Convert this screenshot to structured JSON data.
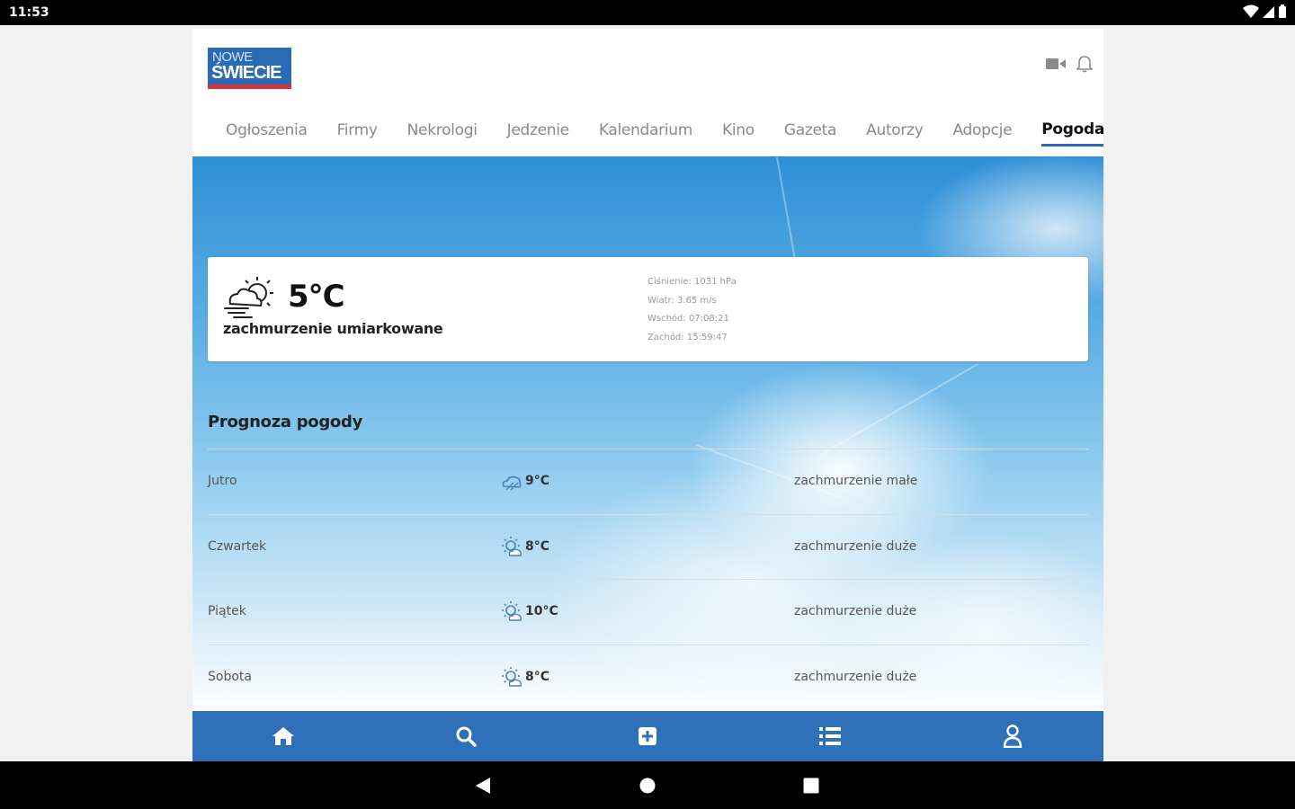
{
  "status_bar": {
    "time": "11:53"
  },
  "brand": {
    "line1": "NOWE",
    "line2": "ŚWIECIE",
    "color": "#2a6bb5",
    "accent": "#d8313a"
  },
  "header": {
    "icons": [
      "video-icon",
      "bell-icon"
    ]
  },
  "nav": {
    "items": [
      {
        "label": "Ogłoszenia"
      },
      {
        "label": "Firmy"
      },
      {
        "label": "Nekrologi"
      },
      {
        "label": "Jedzenie"
      },
      {
        "label": "Kalendarium"
      },
      {
        "label": "Kino"
      },
      {
        "label": "Gazeta"
      },
      {
        "label": "Autorzy"
      },
      {
        "label": "Adopcje"
      },
      {
        "label": "Pogoda"
      }
    ],
    "active": "Pogoda"
  },
  "current": {
    "icon": "partly-cloudy-wind-icon",
    "temp": "5°C",
    "description": "zachmurzenie umiarkowane",
    "details": {
      "pressure": "Ciśnienie: 1031 hPa",
      "wind": "Wiatr: 3.65 m/s",
      "sunrise": "Wschód: 07:08:21",
      "sunset": "Zachód: 15:59:47"
    }
  },
  "forecast": {
    "title": "Prognoza pogody",
    "rows": [
      {
        "day": "Jutro",
        "icon": "cloud-icon",
        "temp": "9°C",
        "desc": "zachmurzenie małe"
      },
      {
        "day": "Czwartek",
        "icon": "sun-cloud-icon",
        "temp": "8°C",
        "desc": "zachmurzenie duże"
      },
      {
        "day": "Piątek",
        "icon": "sun-cloud-icon",
        "temp": "10°C",
        "desc": "zachmurzenie duże"
      },
      {
        "day": "Sobota",
        "icon": "sun-cloud-icon",
        "temp": "8°C",
        "desc": "zachmurzenie duże"
      }
    ]
  },
  "bottom_nav": {
    "icons": [
      "home-icon",
      "search-icon",
      "add-icon",
      "list-icon",
      "user-icon"
    ],
    "color": "#2f71b8"
  },
  "system_nav": {
    "icons": [
      "back-icon",
      "home-circle-icon",
      "recents-icon"
    ]
  }
}
